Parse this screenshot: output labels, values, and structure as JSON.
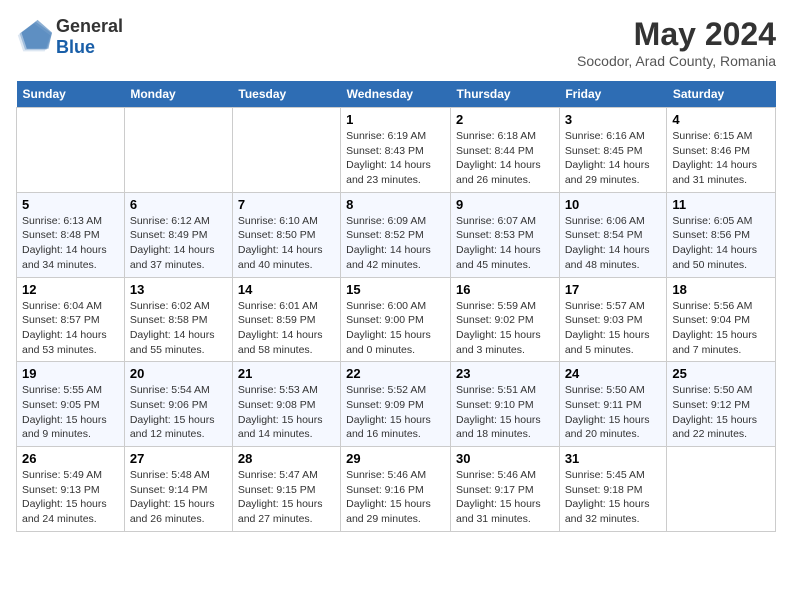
{
  "logo": {
    "general": "General",
    "blue": "Blue"
  },
  "title": "May 2024",
  "location": "Socodor, Arad County, Romania",
  "days_of_week": [
    "Sunday",
    "Monday",
    "Tuesday",
    "Wednesday",
    "Thursday",
    "Friday",
    "Saturday"
  ],
  "weeks": [
    [
      {
        "day": "",
        "info": ""
      },
      {
        "day": "",
        "info": ""
      },
      {
        "day": "",
        "info": ""
      },
      {
        "day": "1",
        "info": "Sunrise: 6:19 AM\nSunset: 8:43 PM\nDaylight: 14 hours\nand 23 minutes."
      },
      {
        "day": "2",
        "info": "Sunrise: 6:18 AM\nSunset: 8:44 PM\nDaylight: 14 hours\nand 26 minutes."
      },
      {
        "day": "3",
        "info": "Sunrise: 6:16 AM\nSunset: 8:45 PM\nDaylight: 14 hours\nand 29 minutes."
      },
      {
        "day": "4",
        "info": "Sunrise: 6:15 AM\nSunset: 8:46 PM\nDaylight: 14 hours\nand 31 minutes."
      }
    ],
    [
      {
        "day": "5",
        "info": "Sunrise: 6:13 AM\nSunset: 8:48 PM\nDaylight: 14 hours\nand 34 minutes."
      },
      {
        "day": "6",
        "info": "Sunrise: 6:12 AM\nSunset: 8:49 PM\nDaylight: 14 hours\nand 37 minutes."
      },
      {
        "day": "7",
        "info": "Sunrise: 6:10 AM\nSunset: 8:50 PM\nDaylight: 14 hours\nand 40 minutes."
      },
      {
        "day": "8",
        "info": "Sunrise: 6:09 AM\nSunset: 8:52 PM\nDaylight: 14 hours\nand 42 minutes."
      },
      {
        "day": "9",
        "info": "Sunrise: 6:07 AM\nSunset: 8:53 PM\nDaylight: 14 hours\nand 45 minutes."
      },
      {
        "day": "10",
        "info": "Sunrise: 6:06 AM\nSunset: 8:54 PM\nDaylight: 14 hours\nand 48 minutes."
      },
      {
        "day": "11",
        "info": "Sunrise: 6:05 AM\nSunset: 8:56 PM\nDaylight: 14 hours\nand 50 minutes."
      }
    ],
    [
      {
        "day": "12",
        "info": "Sunrise: 6:04 AM\nSunset: 8:57 PM\nDaylight: 14 hours\nand 53 minutes."
      },
      {
        "day": "13",
        "info": "Sunrise: 6:02 AM\nSunset: 8:58 PM\nDaylight: 14 hours\nand 55 minutes."
      },
      {
        "day": "14",
        "info": "Sunrise: 6:01 AM\nSunset: 8:59 PM\nDaylight: 14 hours\nand 58 minutes."
      },
      {
        "day": "15",
        "info": "Sunrise: 6:00 AM\nSunset: 9:00 PM\nDaylight: 15 hours\nand 0 minutes."
      },
      {
        "day": "16",
        "info": "Sunrise: 5:59 AM\nSunset: 9:02 PM\nDaylight: 15 hours\nand 3 minutes."
      },
      {
        "day": "17",
        "info": "Sunrise: 5:57 AM\nSunset: 9:03 PM\nDaylight: 15 hours\nand 5 minutes."
      },
      {
        "day": "18",
        "info": "Sunrise: 5:56 AM\nSunset: 9:04 PM\nDaylight: 15 hours\nand 7 minutes."
      }
    ],
    [
      {
        "day": "19",
        "info": "Sunrise: 5:55 AM\nSunset: 9:05 PM\nDaylight: 15 hours\nand 9 minutes."
      },
      {
        "day": "20",
        "info": "Sunrise: 5:54 AM\nSunset: 9:06 PM\nDaylight: 15 hours\nand 12 minutes."
      },
      {
        "day": "21",
        "info": "Sunrise: 5:53 AM\nSunset: 9:08 PM\nDaylight: 15 hours\nand 14 minutes."
      },
      {
        "day": "22",
        "info": "Sunrise: 5:52 AM\nSunset: 9:09 PM\nDaylight: 15 hours\nand 16 minutes."
      },
      {
        "day": "23",
        "info": "Sunrise: 5:51 AM\nSunset: 9:10 PM\nDaylight: 15 hours\nand 18 minutes."
      },
      {
        "day": "24",
        "info": "Sunrise: 5:50 AM\nSunset: 9:11 PM\nDaylight: 15 hours\nand 20 minutes."
      },
      {
        "day": "25",
        "info": "Sunrise: 5:50 AM\nSunset: 9:12 PM\nDaylight: 15 hours\nand 22 minutes."
      }
    ],
    [
      {
        "day": "26",
        "info": "Sunrise: 5:49 AM\nSunset: 9:13 PM\nDaylight: 15 hours\nand 24 minutes."
      },
      {
        "day": "27",
        "info": "Sunrise: 5:48 AM\nSunset: 9:14 PM\nDaylight: 15 hours\nand 26 minutes."
      },
      {
        "day": "28",
        "info": "Sunrise: 5:47 AM\nSunset: 9:15 PM\nDaylight: 15 hours\nand 27 minutes."
      },
      {
        "day": "29",
        "info": "Sunrise: 5:46 AM\nSunset: 9:16 PM\nDaylight: 15 hours\nand 29 minutes."
      },
      {
        "day": "30",
        "info": "Sunrise: 5:46 AM\nSunset: 9:17 PM\nDaylight: 15 hours\nand 31 minutes."
      },
      {
        "day": "31",
        "info": "Sunrise: 5:45 AM\nSunset: 9:18 PM\nDaylight: 15 hours\nand 32 minutes."
      },
      {
        "day": "",
        "info": ""
      }
    ]
  ]
}
